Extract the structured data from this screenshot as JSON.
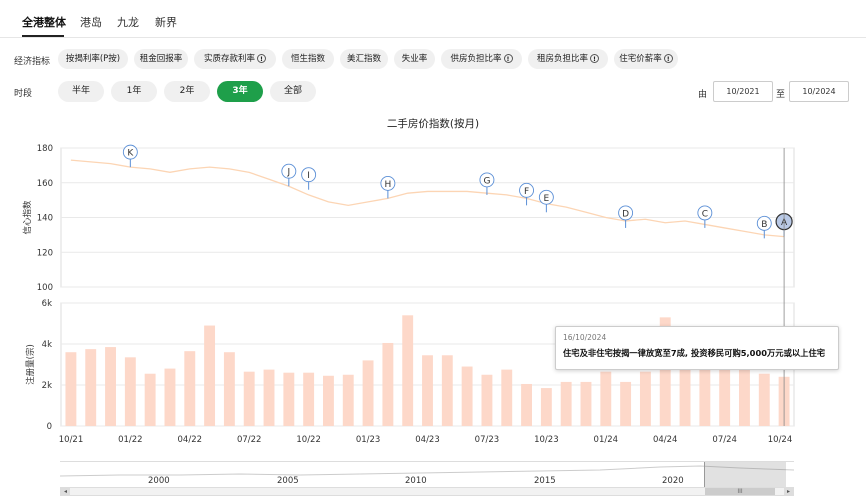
{
  "region_tabs": [
    "全港整体",
    "港岛",
    "九龙",
    "新界"
  ],
  "indicators": {
    "label": "经济指标",
    "items": [
      {
        "label": "按揭利率(P按)",
        "info": false
      },
      {
        "label": "租金回报率",
        "info": false
      },
      {
        "label": "实质存款利率",
        "info": true
      },
      {
        "label": "恒生指数",
        "info": false
      },
      {
        "label": "美汇指数",
        "info": false
      },
      {
        "label": "失业率",
        "info": false
      },
      {
        "label": "供房负担比率",
        "info": true
      },
      {
        "label": "租房负担比率",
        "info": true
      },
      {
        "label": "住宅价薪率",
        "info": true
      }
    ],
    "info_glyph": "!"
  },
  "period": {
    "label": "时段",
    "options": [
      "半年",
      "1年",
      "2年",
      "3年",
      "全部"
    ],
    "selected": "3年",
    "from_label": "由",
    "from_value": "10/2021",
    "to_label": "至",
    "to_value": "10/2024"
  },
  "chart_title": "二手房价指数(按月)",
  "tooltip": {
    "date": "16/10/2024",
    "text": "住宅及非住宅按揭一律放宽至7成, 投资移民可购5,000万元或以上住宅"
  },
  "navigator": {
    "years": [
      "2000",
      "2005",
      "2010",
      "2015",
      "2020"
    ],
    "scroll_thumb": "III",
    "left_arrow": "◂",
    "right_arrow": "▸"
  },
  "colors": {
    "accent_green": "#1e9f4a",
    "line": "#fcd5b4",
    "bar": "#fdd8c9",
    "marker_border": "#5b8fd6",
    "marker_selected": "#b9c9e6"
  },
  "chart_data": [
    {
      "type": "line",
      "ylabel": "信心指数",
      "ylim": [
        100,
        180
      ],
      "yticks": [
        100,
        120,
        140,
        160,
        180
      ],
      "x": [
        "10/21",
        "11/21",
        "12/21",
        "01/22",
        "02/22",
        "03/22",
        "04/22",
        "05/22",
        "06/22",
        "07/22",
        "08/22",
        "09/22",
        "10/22",
        "11/22",
        "12/22",
        "01/23",
        "02/23",
        "03/23",
        "04/23",
        "05/23",
        "06/23",
        "07/23",
        "08/23",
        "09/23",
        "10/23",
        "11/23",
        "12/23",
        "01/24",
        "02/24",
        "03/24",
        "04/24",
        "05/24",
        "06/24",
        "07/24",
        "08/24",
        "09/24",
        "10/24"
      ],
      "values": [
        173,
        172,
        171,
        169,
        168,
        166,
        168,
        169,
        168,
        166,
        162,
        158,
        153,
        149,
        147,
        149,
        151,
        154,
        155,
        155,
        155,
        154,
        153,
        151,
        148,
        146,
        143,
        140,
        138,
        139,
        137,
        138,
        136,
        134,
        132,
        130,
        129
      ],
      "event_markers": [
        {
          "label": "K",
          "x": "01/22",
          "value": 169
        },
        {
          "label": "J",
          "x": "09/22",
          "value": 158
        },
        {
          "label": "I",
          "x": "10/22",
          "value": 156
        },
        {
          "label": "H",
          "x": "02/23",
          "value": 151
        },
        {
          "label": "G",
          "x": "07/23",
          "value": 153
        },
        {
          "label": "F",
          "x": "09/23",
          "value": 147
        },
        {
          "label": "E",
          "x": "10/23",
          "value": 143
        },
        {
          "label": "D",
          "x": "02/24",
          "value": 134
        },
        {
          "label": "C",
          "x": "06/24",
          "value": 134
        },
        {
          "label": "B",
          "x": "09/24",
          "value": 128
        },
        {
          "label": "A",
          "x": "10/24",
          "value": 129,
          "selected": true
        }
      ]
    },
    {
      "type": "bar",
      "ylabel": "注册量(宗)",
      "ylim": [
        0,
        6000
      ],
      "ytick_labels": [
        "0",
        "2k",
        "4k",
        "6k"
      ],
      "x_tick_labels": [
        "10/21",
        "01/22",
        "04/22",
        "07/22",
        "10/22",
        "01/23",
        "04/23",
        "07/23",
        "10/23",
        "01/24",
        "04/24",
        "07/24",
        "10/24"
      ],
      "values": [
        3600,
        3750,
        3850,
        3350,
        2550,
        2800,
        3650,
        4900,
        3600,
        2650,
        2750,
        2600,
        2600,
        2450,
        2500,
        3200,
        4050,
        5400,
        3450,
        3450,
        2900,
        2500,
        2750,
        2050,
        1850,
        2150,
        2150,
        2650,
        2150,
        2650,
        5300,
        3000,
        2800,
        2750,
        2800,
        2550,
        2400
      ]
    }
  ]
}
